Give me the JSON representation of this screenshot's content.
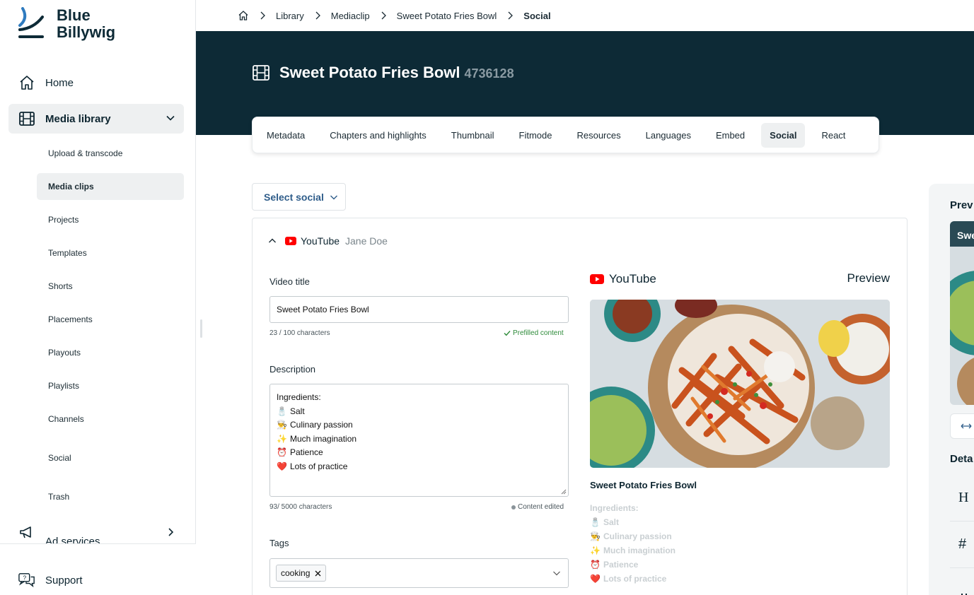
{
  "brand": {
    "line1": "Blue",
    "line2": "Billywig"
  },
  "sidebar": {
    "home": "Home",
    "media_library": "Media library",
    "sub_items": [
      "Upload & transcode",
      "Media clips",
      "Projects",
      "Templates",
      "Shorts",
      "Placements",
      "Playouts",
      "Playlists",
      "Channels",
      "Social",
      "Trash"
    ],
    "ad_services": "Ad services",
    "support": "Support"
  },
  "breadcrumb": {
    "items": [
      "Library",
      "Mediaclip",
      "Sweet Potato Fries Bowl"
    ],
    "current": "Social"
  },
  "header": {
    "title": "Sweet Potato Fries Bowl",
    "id": "4736128"
  },
  "tabs": [
    "Metadata",
    "Chapters and highlights",
    "Thumbnail",
    "Fitmode",
    "Resources",
    "Languages",
    "Embed",
    "Social",
    "React"
  ],
  "select_social": {
    "label": "Select social"
  },
  "social_card": {
    "platform": "YouTube",
    "account": "Jane Doe",
    "video_title_label": "Video title",
    "video_title_value": "Sweet Potato Fries Bowl",
    "title_count": "23 / 100 characters",
    "title_status": "Prefilled content",
    "description_label": "Description",
    "description_heading": "Ingredients:",
    "description_lines": [
      {
        "emoji": "🧂",
        "text": "Salt"
      },
      {
        "emoji": "👨‍🍳",
        "text": "Culinary passion"
      },
      {
        "emoji": "✨",
        "text": "Much imagination"
      },
      {
        "emoji": "⏰",
        "text": "Patience"
      },
      {
        "emoji": "❤️",
        "text": "Lots of practice"
      }
    ],
    "description_count": "93/ 5000 characters",
    "description_status": "Content edited",
    "tags_label": "Tags",
    "tags": [
      "cooking"
    ]
  },
  "preview": {
    "platform": "YouTube",
    "label": "Preview",
    "title": "Sweet Potato Fries Bowl"
  },
  "right_panel": {
    "title": "Prev",
    "thumb_text": "Swe",
    "details": "Deta",
    "row1": "H",
    "row2": "#"
  },
  "colors": {
    "navy": "#0d2a36",
    "youtube_red": "#ff0000",
    "link_blue": "#2f5d8a",
    "success": "#2e8b3a"
  }
}
